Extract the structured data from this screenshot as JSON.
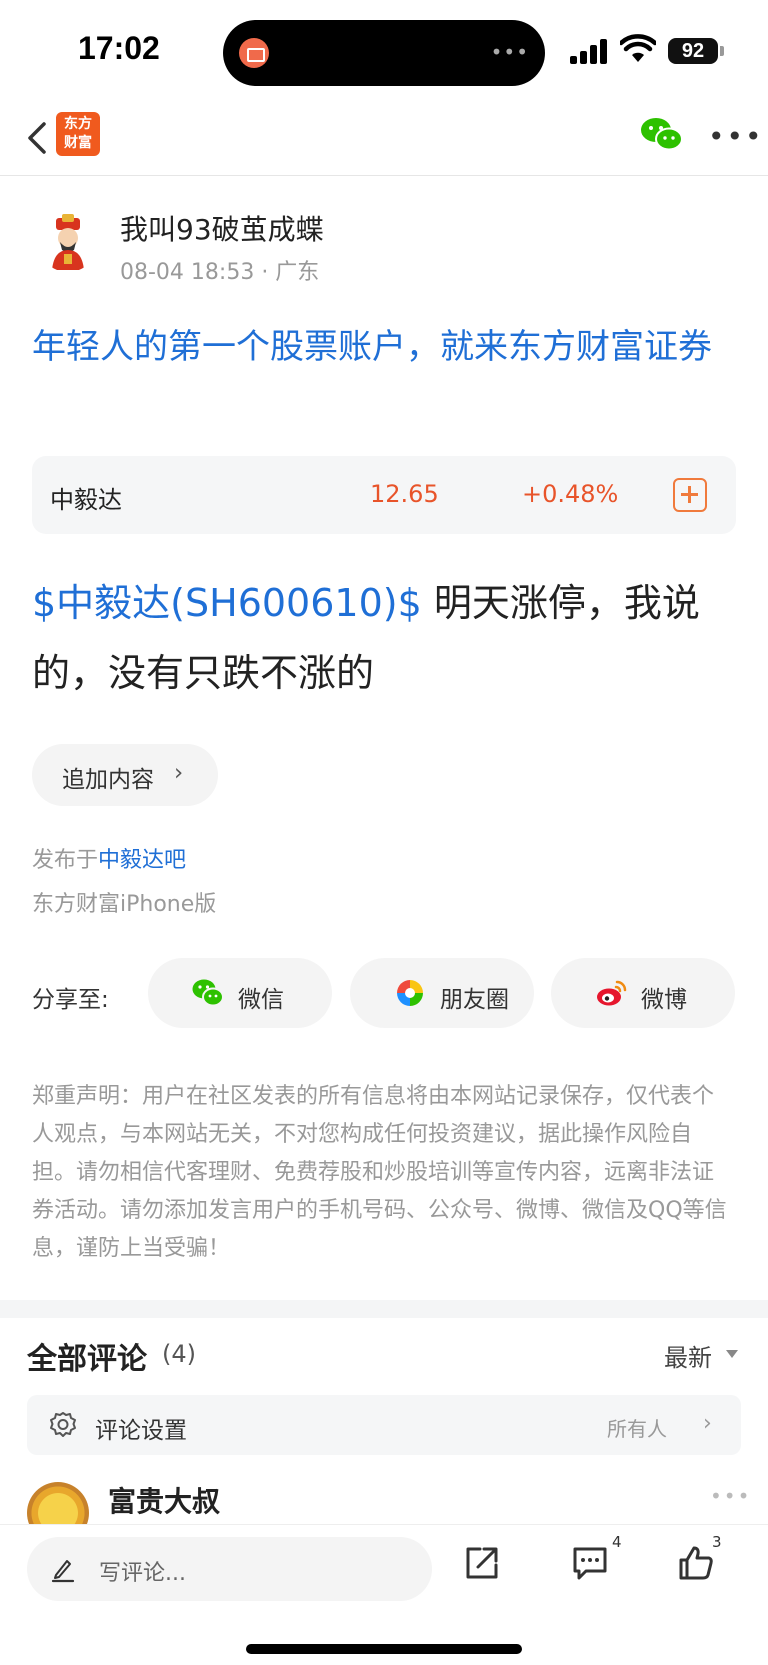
{
  "status": {
    "time": "17:02",
    "battery": "92"
  },
  "nav": {
    "logo_line1": "东方",
    "logo_line2": "财富"
  },
  "author": {
    "name": "我叫93破茧成蝶",
    "meta": "08-04 18:53 · 广东"
  },
  "ad": {
    "text": "年轻人的第一个股票账户，就来东方财富证券"
  },
  "stock": {
    "name": "中毅达",
    "price": "12.65",
    "change": "+0.48%"
  },
  "post": {
    "stock_tag": "$中毅达(SH600610)$",
    "text": "  明天涨停，我说的，没有只跌不涨的"
  },
  "append": {
    "label": "追加内容",
    "chevron": "›"
  },
  "published": {
    "prefix": "发布于",
    "bar": "中毅达吧",
    "client": "东方财富iPhone版"
  },
  "share": {
    "label": "分享至:",
    "targets": [
      {
        "label": "微信",
        "icon": "wechat-icon"
      },
      {
        "label": "朋友圈",
        "icon": "moments-icon"
      },
      {
        "label": "微博",
        "icon": "weibo-icon"
      }
    ]
  },
  "disclaimer": "郑重声明：用户在社区发表的所有信息将由本网站记录保存，仅代表个人观点，与本网站无关，不对您构成任何投资建议，据此操作风险自担。请勿相信代客理财、免费荐股和炒股培训等宣传内容，远离非法证券活动。请勿添加发言用户的手机号码、公众号、微博、微信及QQ等信息，谨防上当受骗！",
  "comments": {
    "title": "全部评论",
    "count": "(4)",
    "sort": "最新",
    "settings_label": "评论设置",
    "settings_value": "所有人",
    "settings_chevron": "›",
    "first_commenter": "富贵大叔"
  },
  "bottom": {
    "placeholder": "写评论...",
    "comment_count": "4",
    "like_count": "3"
  },
  "colors": {
    "link": "#1f6fd6",
    "up": "#e8542a",
    "brand": "#f05a1e"
  }
}
